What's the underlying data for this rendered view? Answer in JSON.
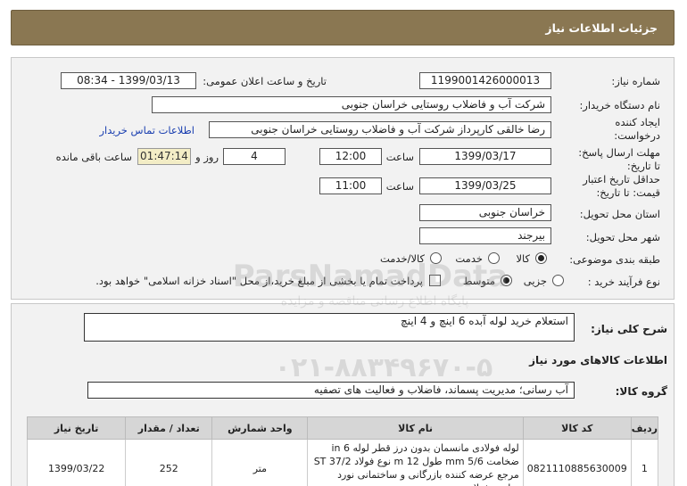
{
  "header": {
    "title": "جزئیات اطلاعات نیاز"
  },
  "fields": {
    "need_number_label": "شماره نیاز:",
    "need_number": "1199001426000013",
    "announce_label": "تاریخ و ساعت اعلان عمومی:",
    "announce_value": "1399/03/13 - 08:34",
    "buyer_label": "نام دستگاه خریدار:",
    "buyer_value": "شرکت آب و فاضلاب روستایی خراسان جنوبی",
    "creator_label_1": "ایجاد کننده",
    "creator_label_2": "درخواست:",
    "creator_value": "رضا  خالقی کارپرداز شرکت آب و فاضلاب روستایی خراسان جنوبی",
    "contact_link": "اطلاعات تماس خریدار",
    "deadline_label_1": "مهلت ارسال پاسخ:",
    "deadline_label_2": "تا تاریخ:",
    "deadline_date": "1399/03/17",
    "time_label": "ساعت",
    "deadline_time": "12:00",
    "days_value": "4",
    "days_label": "روز و",
    "remaining_time": "01:47:14",
    "remaining_label": "ساعت باقی مانده",
    "validity_label_1": "حداقل تاریخ اعتبار",
    "validity_label_2": "قیمت: تا تاریخ:",
    "validity_date": "1399/03/25",
    "validity_time": "11:00",
    "province_label": "استان محل تحویل:",
    "province_value": "خراسان جنوبی",
    "city_label": "شهر محل تحویل:",
    "city_value": "بیرجند",
    "category_label": "طبقه بندی موضوعی:",
    "category_options": [
      "کالا",
      "خدمت",
      "کالا/خدمت"
    ],
    "category_selected": "کالا",
    "process_label": "نوع فرآیند خرید :",
    "process_options": [
      "جزیی",
      "متوسط"
    ],
    "process_selected": "متوسط",
    "payment_note": "پرداخت تمام یا بخشی از مبلغ خرید،از محل \"اسناد خزانه اسلامی\" خواهد بود."
  },
  "summary": {
    "label": "شرح کلی نیاز:",
    "value": "استعلام خرید لوله آبده 6 اینچ و 4 اینچ"
  },
  "goods": {
    "section_title": "اطلاعات کالاهای مورد نیاز",
    "group_label": "گروه کالا:",
    "group_value": "آب رسانی؛ مدیریت پسماند، فاضلاب و فعالیت های تصفیه"
  },
  "table": {
    "columns": [
      "ردیف",
      "کد کالا",
      "نام کالا",
      "واحد شمارش",
      "تعداد / مقدار",
      "تاریخ نیاز"
    ],
    "rows": [
      {
        "index": "1",
        "code": "0821110885630009",
        "name": "لوله فولادی مانسمان بدون درز قطر لوله 6 in ضخامت 5/6 mm طول 12 m نوع فولاد ST 37/2 مرجع عرضه کننده بازرگانی و ساختمانی نورد ساخت فولاد",
        "unit": "متر",
        "qty": "252",
        "date": "1399/03/22"
      }
    ]
  },
  "watermark": {
    "brand": "ParsNamadData",
    "subtitle": "پایگاه اطلاع رسانی مناقصه و مزایده",
    "phone": "۰۲۱-۸۸۳۴۹۶۷۰-۵"
  }
}
